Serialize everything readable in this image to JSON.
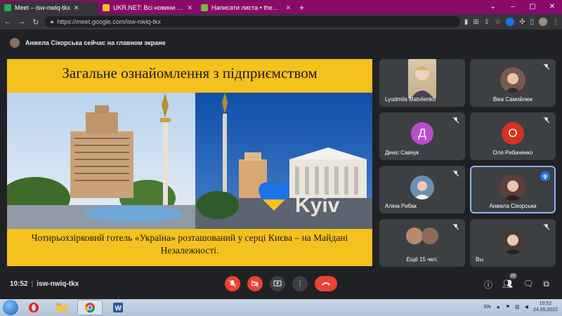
{
  "browser": {
    "tabs": [
      {
        "label": "Meet – isw-nwiq-tkx",
        "active": true,
        "favicon_color": "#34a853"
      },
      {
        "label": "UKR.NET: Всі новини України, о",
        "active": false,
        "favicon_color": "#f5c11e"
      },
      {
        "label": "Написати листа • theprincess@",
        "active": false,
        "favicon_color": "#7cb342"
      }
    ],
    "url": "https://meet.google.com/isw-nwiq-tkx"
  },
  "meeting": {
    "presenter_notice": "Анжела Сікорська сейчас на главном экране",
    "time": "10:52",
    "code": "isw-nwiq-tkx",
    "participants_badge": "23"
  },
  "slide": {
    "title": "Загальне ознайомлення з підприємством",
    "caption": "Чотирьохзірковий готель «Україна» розташований у серці Києва – на Майдані Незалежності.",
    "sign_text": "Kyiv"
  },
  "tiles": [
    {
      "name": "Lyudmila Matviienko",
      "muted": false
    },
    {
      "name": "Віка Самойлюк",
      "muted": true
    },
    {
      "name": "Деніс Савчук",
      "muted": true,
      "letter": "Д",
      "color": "#b84fc8"
    },
    {
      "name": "Оля Рибаченко",
      "muted": true,
      "letter": "О",
      "color": "#d93025"
    },
    {
      "name": "Аліна Рибак",
      "muted": true
    },
    {
      "name": "Анжела Сікорська",
      "speaking": true
    },
    {
      "name": "Ещё 15 чел.",
      "muted": true
    },
    {
      "name": "Вы",
      "muted": true
    }
  ],
  "taskbar": {
    "lang": "EN",
    "clock_time": "10:52",
    "clock_date": "24.05.2022"
  },
  "colors": {
    "slide_bg": "#f5c11e",
    "meet_bg": "#202124",
    "tile_bg": "#3c4043",
    "end_call": "#ea4335",
    "active_border": "#8ab4f8"
  }
}
